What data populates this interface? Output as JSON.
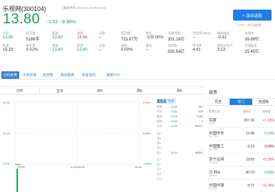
{
  "header": {
    "name": "乐视网(300104)",
    "update_time": "最後更新 2018-01-24  09:26:03",
    "price": "13.80",
    "change": "-1.53",
    "change_pct": "-9.98%",
    "add_button": "+ 加自选股",
    "followers": "14793 人关注该股票"
  },
  "metrics": [
    {
      "k1": "今开",
      "v1": "13.80",
      "c1": "g",
      "k2": "昨收",
      "v2": "15.33",
      "c2": ""
    },
    {
      "k1": "成交量",
      "v1": "5186手",
      "c1": "",
      "k2": "换手率",
      "v2": "0.02%",
      "c2": ""
    },
    {
      "k1": "最高",
      "v1": "13.80",
      "c1": "g",
      "k2": "最低",
      "v2": "13.80",
      "c2": "g"
    },
    {
      "k1": "涨停",
      "v1": "16.86",
      "c1": "r",
      "k2": "跌停",
      "v2": "13.80",
      "c2": "g"
    },
    {
      "k1": "内盘",
      "v1": "--",
      "c1": "",
      "k2": "外盘",
      "v2": "--",
      "c2": ""
    },
    {
      "k1": "成交额",
      "v1": "715.67万",
      "c1": "",
      "k2": "振幅",
      "v2": "0.00%",
      "c2": ""
    },
    {
      "k1": "委比",
      "v1": "-100.00%",
      "c1": "",
      "k2": "量比",
      "v2": "--",
      "c2": ""
    },
    {
      "k1": "流通市值",
      "v1": "351.19亿",
      "c1": "",
      "k2": "总市值",
      "v2": "550.54亿",
      "c2": ""
    },
    {
      "k1": "市盈率(MRQ)",
      "v1": "--",
      "c1": "",
      "k2": "市净率",
      "v2": "4.41",
      "c2": ""
    },
    {
      "k1": "每股收益",
      "v1": "-0.41",
      "c1": "",
      "k2": "每股净资产",
      "v2": "3.13",
      "c2": ""
    },
    {
      "k1": "总股本",
      "v1": "39.89亿",
      "c1": "",
      "k2": "流通股本",
      "v2": "25.45亿",
      "c2": ""
    }
  ],
  "tabs": [
    "分时走势",
    "大宗交易",
    "龙虎榜",
    "融资融券",
    "资金流向",
    "最新F10"
  ],
  "periods": [
    "分时",
    "五日",
    "日K",
    "周K",
    "月K"
  ],
  "chart": {
    "y_left": [
      "16.86",
      "15.33",
      "13.80"
    ],
    "y_right": [
      "9.98%",
      "0.00%",
      "-9.98%"
    ],
    "x_ticks": [
      "09:30",
      "11:30/13:00",
      "15:00"
    ],
    "book_tabs": [
      "五档",
      "明细"
    ],
    "sell": [
      {
        "label": "卖5",
        "price": "",
        "vol": ""
      },
      {
        "label": "卖4",
        "price": "",
        "vol": ""
      },
      {
        "label": "卖3",
        "price": "",
        "vol": ""
      },
      {
        "label": "卖2",
        "price": "",
        "vol": ""
      },
      {
        "label": "卖1",
        "price": "13.80",
        "vol": "65591"
      }
    ],
    "rows_top": [
      {
        "label": "最新",
        "price": "13.80",
        "vol": "151"
      },
      {
        "label": "今开",
        "price": "13.80",
        "vol": "105"
      },
      {
        "label": "最高",
        "price": "13.80",
        "vol": "5186"
      },
      {
        "label": "最低",
        "price": "13.80",
        "vol": "4"
      },
      {
        "label": "成交",
        "price": "13.80",
        "vol": "65591"
      }
    ],
    "buy": [
      {
        "label": "买1",
        "price": "",
        "vol": ""
      },
      {
        "label": "买2",
        "price": "",
        "vol": ""
      },
      {
        "label": "买3",
        "price": "",
        "vol": ""
      },
      {
        "label": "买4",
        "price": "",
        "vol": ""
      },
      {
        "label": "买5",
        "price": "",
        "vol": ""
      }
    ]
  },
  "right_panel": {
    "title": "股票",
    "tabs": [
      "历史",
      "热门",
      "自选股"
    ],
    "headers": [
      "股票名称",
      "最新价",
      "涨跌幅"
    ],
    "stocks": [
      {
        "name": "百度",
        "code": "BIDU",
        "price": "257.36",
        "chg": "+1.19%",
        "dir": "r"
      },
      {
        "name": "中国中车",
        "code": "601766",
        "price": "12.48",
        "chg": "-0.16%",
        "dir": "g"
      },
      {
        "name": "中国重工",
        "code": "601989",
        "price": "6.23",
        "chg": "0.00%",
        "dir": ""
      },
      {
        "name": "苏宁云商",
        "code": "002024",
        "price": "13.63",
        "chg": "+0.29%",
        "dir": "r"
      },
      {
        "name": "万 科A",
        "code": "000002",
        "price": "40.70",
        "chg": "-0.66%",
        "dir": "g"
      },
      {
        "name": "中国中铁",
        "code": "601390",
        "price": "8.72",
        "chg": "+0.35%",
        "dir": "r"
      }
    ]
  }
}
